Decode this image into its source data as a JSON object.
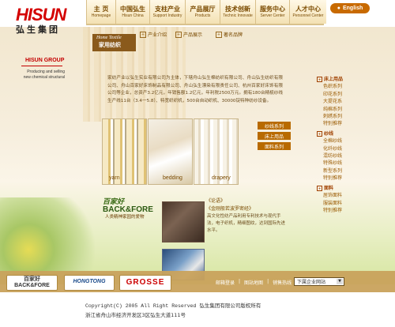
{
  "header": {
    "logo_en": "HISUN",
    "logo_cn": "弘生集团",
    "lang_button": "English",
    "nav": [
      {
        "cn": "主 页",
        "en": "Homepage"
      },
      {
        "cn": "中国弘生",
        "en": "Hisun China"
      },
      {
        "cn": "支柱产业",
        "en": "Support Industry"
      },
      {
        "cn": "产品展厅",
        "en": "Products"
      },
      {
        "cn": "技术创新",
        "en": "Technic Innovate"
      },
      {
        "cn": "服务中心",
        "en": "Server Center"
      },
      {
        "cn": "人才中心",
        "en": "Personnel Center"
      }
    ]
  },
  "left": {
    "group_title": "HISUN GROUP",
    "group_sub_1": "Producing and selling",
    "group_sub_2": "new chemical structural"
  },
  "section": {
    "badge_en": "Home Textile",
    "badge_cn": "家用纺织",
    "tabs": [
      "产业介绍",
      "产品展示",
      "著名品牌"
    ]
  },
  "intro": "家纺产业以弘生实业有限公司为主体，下辖舟山弘生棉纺织有限公司、舟山弘生纺织有限公司、舟山百家好床饰制品有限公司、舟山弘生漂染有限责任公司、杭州百家好床饰有限公司等企业，总资产3.2亿元，年销售额1.2亿元，年利税2500万元。拥有180台精梳纱线生产线11台（3.4一5.8）、特宽织织机，500台自动织机、30000锭特种纺纱设备。",
  "products": [
    {
      "label": "yarn"
    },
    {
      "label": "bedding"
    },
    {
      "label": "drapery"
    }
  ],
  "series_buttons": [
    "纱线系列",
    "床上用品",
    "面料系列"
  ],
  "sidebar": [
    {
      "head": "床上用品",
      "items": [
        "色织系列",
        "印花系列",
        "大提花系",
        "纯棉系列",
        "刺绣系列",
        "特别推荐"
      ]
    },
    {
      "head": "纱线",
      "items": [
        "全棉纱线",
        "化纤纱线",
        "混纺纱线",
        "特殊纱线",
        "新型系列",
        "特别推荐"
      ]
    },
    {
      "head": "面料",
      "items": [
        "居饰面料",
        "服装面料",
        "特别推荐"
      ]
    }
  ],
  "promo": {
    "bf_cn": "百家好",
    "bf_en": "BACK&FORE",
    "bf_tag": "人类精神家园的爱物",
    "book_title_1": "《论语》",
    "book_title_2": "《金刚般若波罗密经》",
    "book_desc": "高文化性纺产品利用专利技术与现代手法，电子织机，精细图纹，达到国际先进水平。"
  },
  "bottom": {
    "brand_bf_cn": "百家好",
    "brand_bf_en": "BACK&FORE",
    "brand_hongtong": "HONGTONG",
    "brand_grosse": "GROSSE",
    "links": [
      "邮箱登录",
      "图站地图",
      "销售热线"
    ],
    "select_value": "下属企业网站"
  },
  "footer": {
    "copyright": "Copyright(C) 2005 All Right Reserved 弘生集团有限公司版权所有",
    "address": "浙江省舟山市经济开发区3区弘生大道111号"
  },
  "colors": {
    "brand_red": "#d40000",
    "accent_brown": "#b86a00",
    "bottom_bar": "#c9a25c"
  }
}
